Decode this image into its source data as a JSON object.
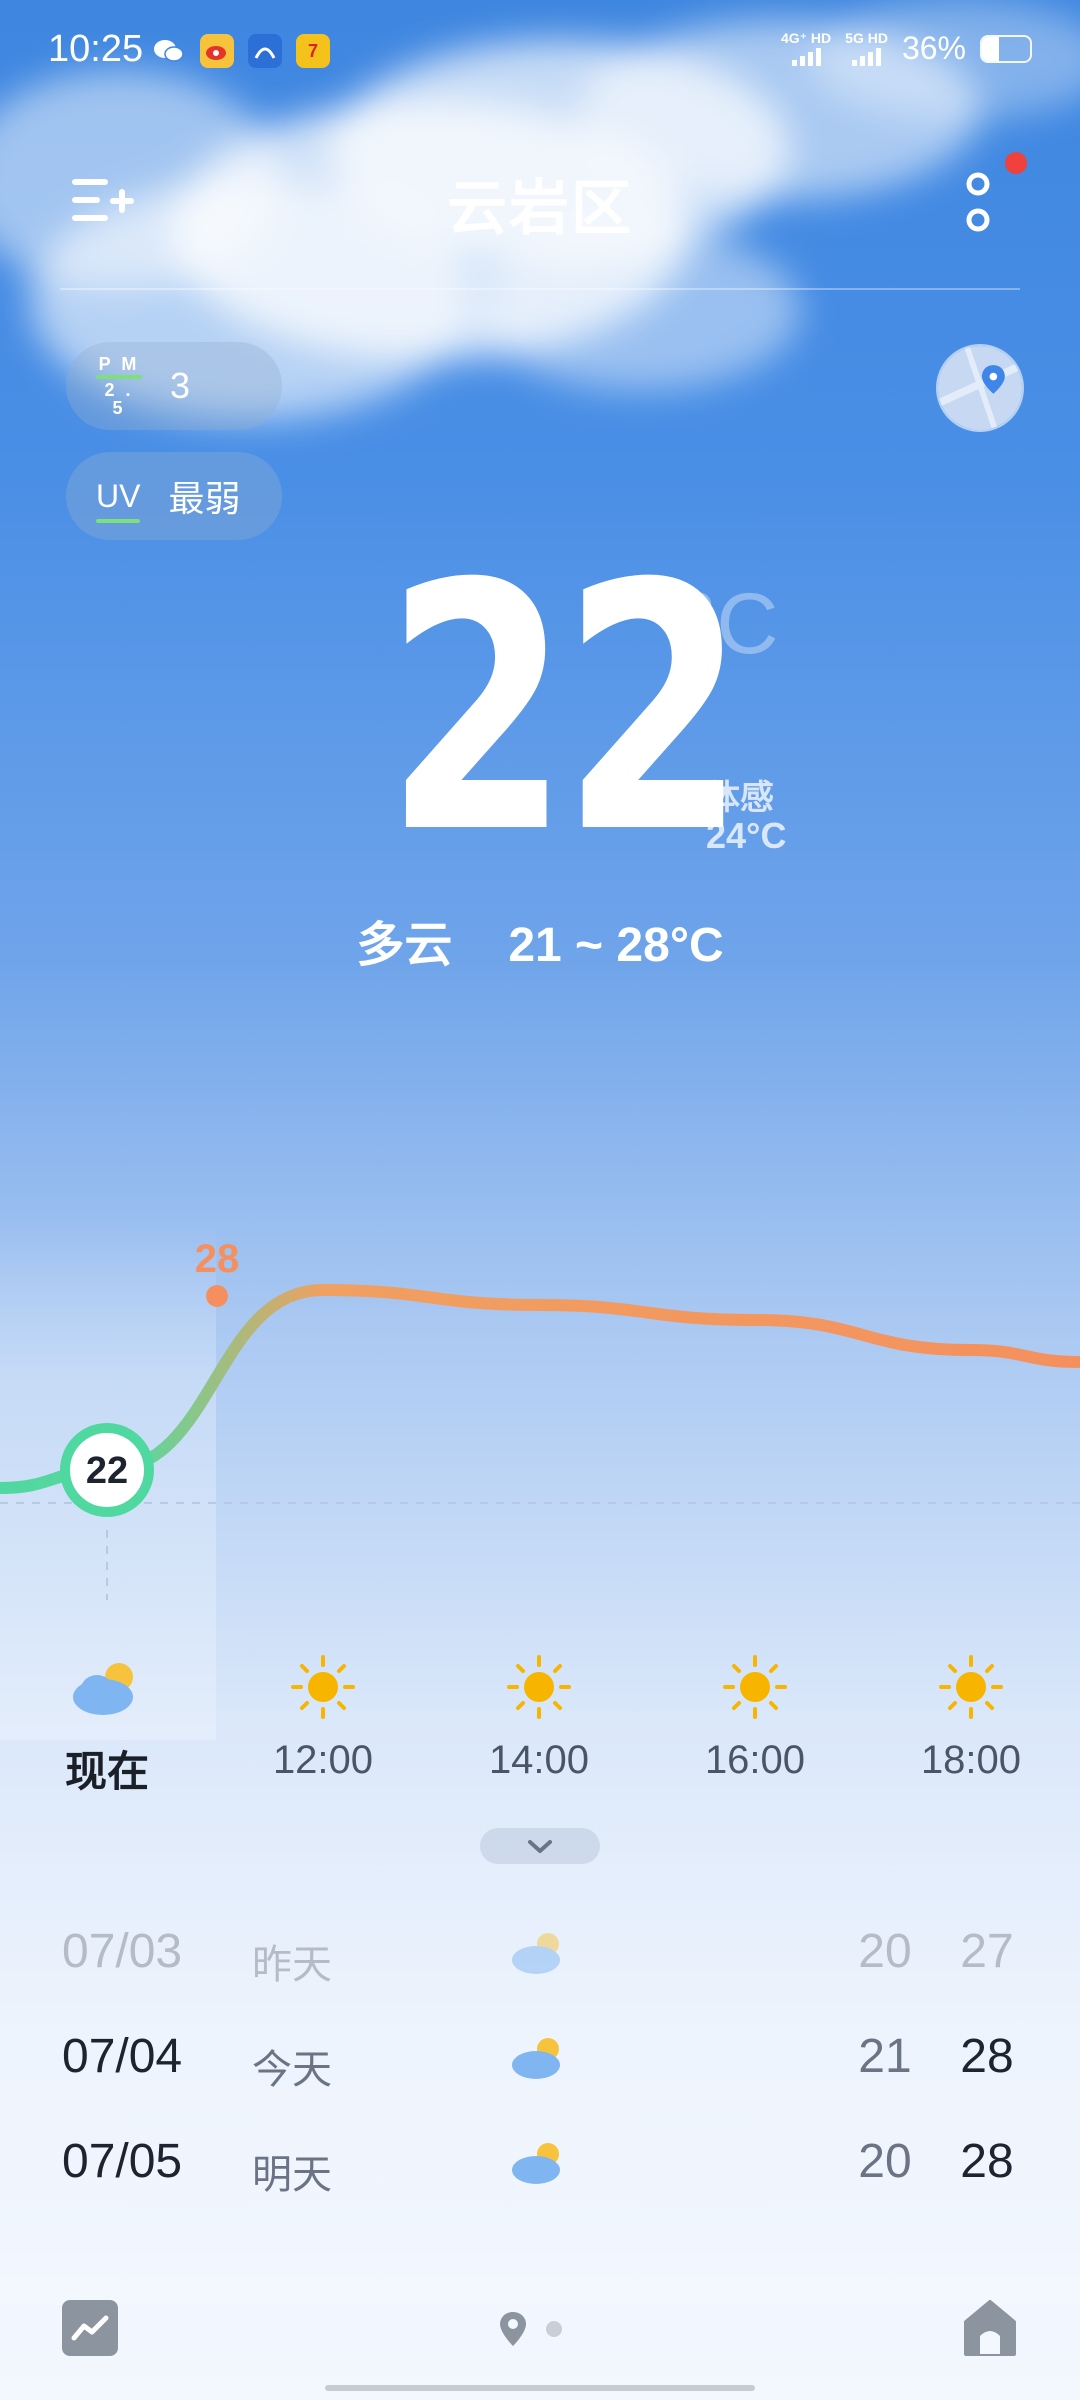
{
  "status_bar": {
    "time": "10:25",
    "network_1": "4G⁺ HD",
    "network_2": "5G HD",
    "battery_text": "36%",
    "battery_level": 0.36
  },
  "header": {
    "city": "云岩区"
  },
  "air": {
    "pm_label": "P M",
    "pm_sub": "2 . 5",
    "pm_value": "3",
    "uv_label": "UV",
    "uv_value": "最弱"
  },
  "current": {
    "temperature": "22",
    "unit": "°C",
    "feels_label": "体感",
    "feels_value": "24°C",
    "condition": "多云",
    "range": "21 ~ 28°C"
  },
  "chart_data": {
    "type": "line",
    "x": [
      "现在",
      "12:00",
      "14:00",
      "16:00",
      "18:00"
    ],
    "values": [
      22,
      28,
      27.5,
      27,
      26
    ],
    "current_label": "22",
    "peak_label": "28",
    "color_now": "#4fd8a0",
    "color_warm": "#f5905e"
  },
  "hourly": [
    {
      "label": "现在",
      "icon": "partly-cloudy-icon"
    },
    {
      "label": "12:00",
      "icon": "sun-icon"
    },
    {
      "label": "14:00",
      "icon": "sun-icon"
    },
    {
      "label": "16:00",
      "icon": "sun-icon"
    },
    {
      "label": "18:00",
      "icon": "sun-icon"
    }
  ],
  "daily": [
    {
      "date": "07/03",
      "day": "昨天",
      "low": "20",
      "high": "27"
    },
    {
      "date": "07/04",
      "day": "今天",
      "low": "21",
      "high": "28"
    },
    {
      "date": "07/05",
      "day": "明天",
      "low": "20",
      "high": "28"
    }
  ]
}
